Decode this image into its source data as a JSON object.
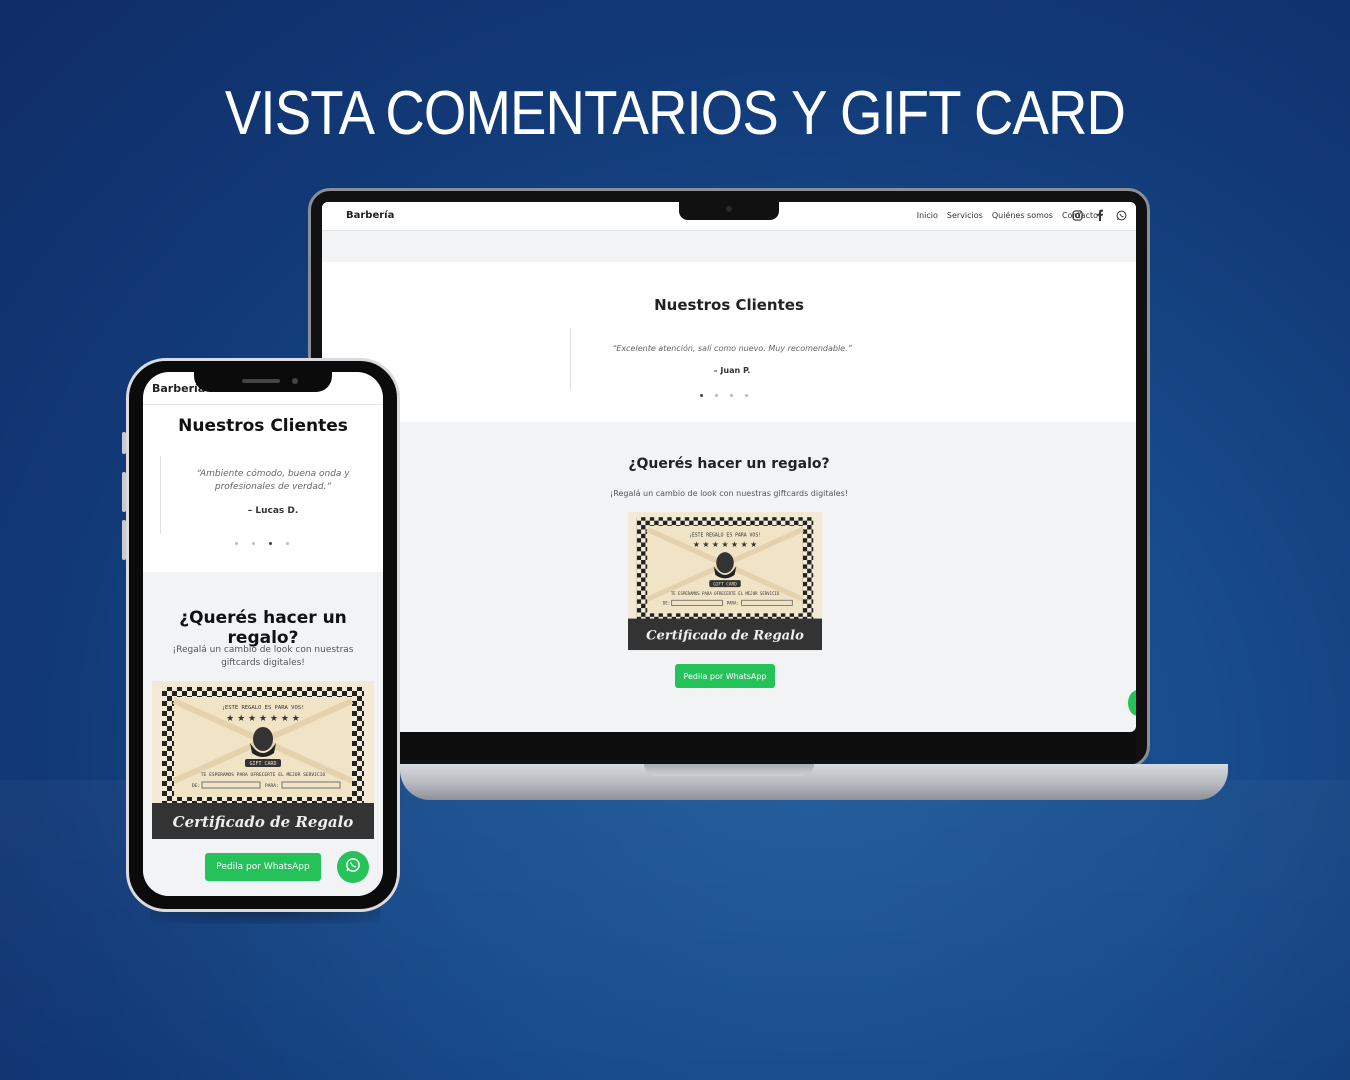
{
  "headline": "VISTA COMENTARIOS Y GIFT CARD",
  "site": {
    "brand": "Barbería",
    "nav_links": [
      "Inicio",
      "Servicios",
      "Quiénes somos",
      "Contacto"
    ],
    "nav_icons": [
      "instagram-icon",
      "facebook-icon",
      "whatsapp-icon"
    ],
    "testimonials_title": "Nuestros Clientes",
    "gift_title": "¿Querés hacer un regalo?",
    "gift_subtitle": "¡Regalá un cambio de look con nuestras giftcards digitales!",
    "whatsapp_button": "Pedila por WhatsApp",
    "card": {
      "top_text": "¡ESTE REGALO ES PARA VOS!",
      "ribbon": "GIFT CARD",
      "tagline": "TE ESPERAMOS PARA OFRECERTE EL MEJOR SERVICIO",
      "de_label": "DE:",
      "para_label": "PARA:",
      "script_title": "Certificado de Regalo"
    },
    "colors": {
      "accent_green": "#25c25a",
      "bg_blue": "#184c8c"
    }
  },
  "laptop": {
    "quote": "“Excelente atención, salí como nuevo. Muy recomendable.”",
    "author": "– Juan P.",
    "active_dot": 1
  },
  "phone": {
    "quote": "“Ambiente cómodo, buena onda y profesionales de verdad.”",
    "author": "– Lucas D.",
    "active_dot": 3
  }
}
